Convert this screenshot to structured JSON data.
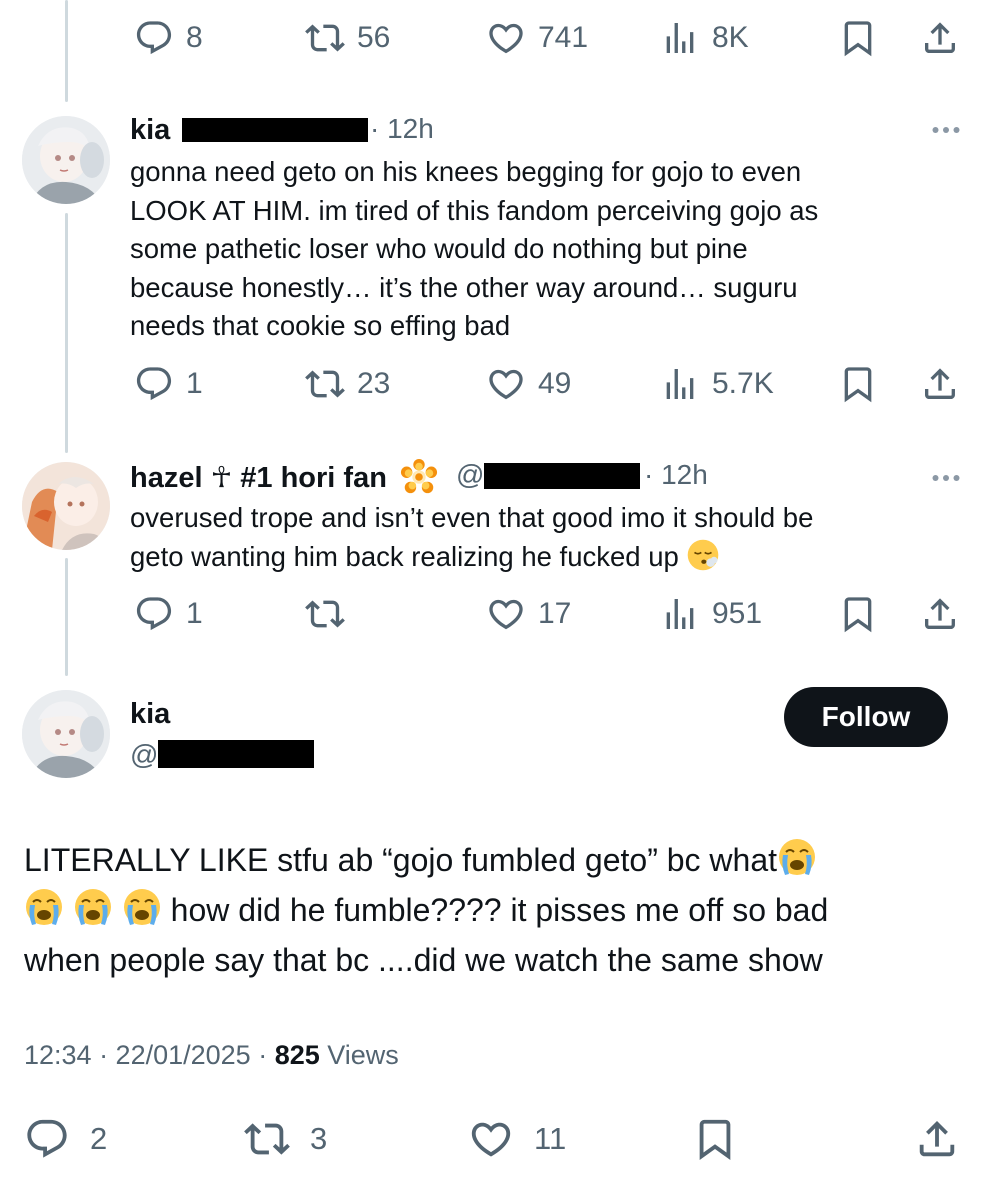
{
  "top_tweet": {
    "replies": "8",
    "reposts": "56",
    "likes": "741",
    "views": "8K"
  },
  "reply1": {
    "name": "kia",
    "time": "· 12h",
    "lines": [
      "gonna need geto on his knees begging for gojo to even",
      "LOOK AT HIM. im tired of this fandom perceiving gojo as",
      "some pathetic loser who would do nothing but pine",
      "because honestly… it’s the other way around… suguru",
      "needs that cookie so effing bad"
    ],
    "replies": "1",
    "reposts": "23",
    "likes": "49",
    "views": "5.7K"
  },
  "reply2": {
    "name": "hazel ☥ #1 hori fan",
    "at": "@",
    "time": "· 12h",
    "lines": [
      "overused trope and isn’t even that good imo it should be",
      "geto wanting him back realizing he fucked up"
    ],
    "replies": "1",
    "reposts": "",
    "likes": "17",
    "views": "951"
  },
  "main_tweet": {
    "name": "kia",
    "handle_prefix": "@",
    "follow_label": "Follow",
    "line1": "LITERALLY LIKE stfu ab “gojo fumbled geto” bc what",
    "line2": " how did he fumble???? it pisses me off so bad",
    "line3": "when people say that bc ....did we watch the same show",
    "time": "12:34 · 22/01/2025 · ",
    "views_count": "825",
    "views_label": " Views",
    "replies": "2",
    "reposts": "3",
    "likes": "11"
  },
  "colors": {
    "text": "#0f1419",
    "secondary": "#536471",
    "thread_line": "#cfd9de",
    "button_bg": "#0f1419"
  },
  "icons": [
    "reply-icon",
    "repost-icon",
    "like-icon",
    "views-icon",
    "bookmark-icon",
    "share-icon",
    "more-icon",
    "loudly-crying-emoji",
    "sweat-emoji",
    "flower-emoji"
  ]
}
